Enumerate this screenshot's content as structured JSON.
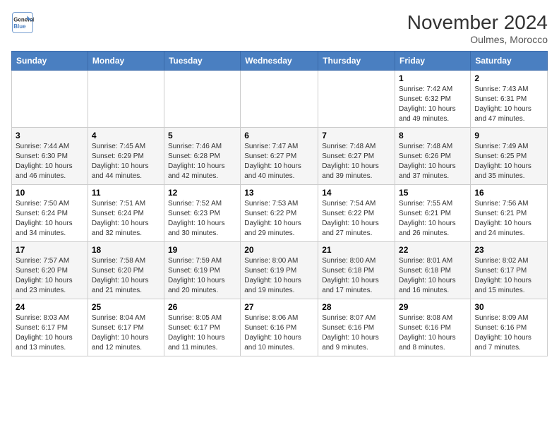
{
  "logo": {
    "line1": "General",
    "line2": "Blue"
  },
  "title": "November 2024",
  "location": "Oulmes, Morocco",
  "headers": [
    "Sunday",
    "Monday",
    "Tuesday",
    "Wednesday",
    "Thursday",
    "Friday",
    "Saturday"
  ],
  "weeks": [
    [
      {
        "day": "",
        "info": ""
      },
      {
        "day": "",
        "info": ""
      },
      {
        "day": "",
        "info": ""
      },
      {
        "day": "",
        "info": ""
      },
      {
        "day": "",
        "info": ""
      },
      {
        "day": "1",
        "info": "Sunrise: 7:42 AM\nSunset: 6:32 PM\nDaylight: 10 hours and 49 minutes."
      },
      {
        "day": "2",
        "info": "Sunrise: 7:43 AM\nSunset: 6:31 PM\nDaylight: 10 hours and 47 minutes."
      }
    ],
    [
      {
        "day": "3",
        "info": "Sunrise: 7:44 AM\nSunset: 6:30 PM\nDaylight: 10 hours and 46 minutes."
      },
      {
        "day": "4",
        "info": "Sunrise: 7:45 AM\nSunset: 6:29 PM\nDaylight: 10 hours and 44 minutes."
      },
      {
        "day": "5",
        "info": "Sunrise: 7:46 AM\nSunset: 6:28 PM\nDaylight: 10 hours and 42 minutes."
      },
      {
        "day": "6",
        "info": "Sunrise: 7:47 AM\nSunset: 6:27 PM\nDaylight: 10 hours and 40 minutes."
      },
      {
        "day": "7",
        "info": "Sunrise: 7:48 AM\nSunset: 6:27 PM\nDaylight: 10 hours and 39 minutes."
      },
      {
        "day": "8",
        "info": "Sunrise: 7:48 AM\nSunset: 6:26 PM\nDaylight: 10 hours and 37 minutes."
      },
      {
        "day": "9",
        "info": "Sunrise: 7:49 AM\nSunset: 6:25 PM\nDaylight: 10 hours and 35 minutes."
      }
    ],
    [
      {
        "day": "10",
        "info": "Sunrise: 7:50 AM\nSunset: 6:24 PM\nDaylight: 10 hours and 34 minutes."
      },
      {
        "day": "11",
        "info": "Sunrise: 7:51 AM\nSunset: 6:24 PM\nDaylight: 10 hours and 32 minutes."
      },
      {
        "day": "12",
        "info": "Sunrise: 7:52 AM\nSunset: 6:23 PM\nDaylight: 10 hours and 30 minutes."
      },
      {
        "day": "13",
        "info": "Sunrise: 7:53 AM\nSunset: 6:22 PM\nDaylight: 10 hours and 29 minutes."
      },
      {
        "day": "14",
        "info": "Sunrise: 7:54 AM\nSunset: 6:22 PM\nDaylight: 10 hours and 27 minutes."
      },
      {
        "day": "15",
        "info": "Sunrise: 7:55 AM\nSunset: 6:21 PM\nDaylight: 10 hours and 26 minutes."
      },
      {
        "day": "16",
        "info": "Sunrise: 7:56 AM\nSunset: 6:21 PM\nDaylight: 10 hours and 24 minutes."
      }
    ],
    [
      {
        "day": "17",
        "info": "Sunrise: 7:57 AM\nSunset: 6:20 PM\nDaylight: 10 hours and 23 minutes."
      },
      {
        "day": "18",
        "info": "Sunrise: 7:58 AM\nSunset: 6:20 PM\nDaylight: 10 hours and 21 minutes."
      },
      {
        "day": "19",
        "info": "Sunrise: 7:59 AM\nSunset: 6:19 PM\nDaylight: 10 hours and 20 minutes."
      },
      {
        "day": "20",
        "info": "Sunrise: 8:00 AM\nSunset: 6:19 PM\nDaylight: 10 hours and 19 minutes."
      },
      {
        "day": "21",
        "info": "Sunrise: 8:00 AM\nSunset: 6:18 PM\nDaylight: 10 hours and 17 minutes."
      },
      {
        "day": "22",
        "info": "Sunrise: 8:01 AM\nSunset: 6:18 PM\nDaylight: 10 hours and 16 minutes."
      },
      {
        "day": "23",
        "info": "Sunrise: 8:02 AM\nSunset: 6:17 PM\nDaylight: 10 hours and 15 minutes."
      }
    ],
    [
      {
        "day": "24",
        "info": "Sunrise: 8:03 AM\nSunset: 6:17 PM\nDaylight: 10 hours and 13 minutes."
      },
      {
        "day": "25",
        "info": "Sunrise: 8:04 AM\nSunset: 6:17 PM\nDaylight: 10 hours and 12 minutes."
      },
      {
        "day": "26",
        "info": "Sunrise: 8:05 AM\nSunset: 6:17 PM\nDaylight: 10 hours and 11 minutes."
      },
      {
        "day": "27",
        "info": "Sunrise: 8:06 AM\nSunset: 6:16 PM\nDaylight: 10 hours and 10 minutes."
      },
      {
        "day": "28",
        "info": "Sunrise: 8:07 AM\nSunset: 6:16 PM\nDaylight: 10 hours and 9 minutes."
      },
      {
        "day": "29",
        "info": "Sunrise: 8:08 AM\nSunset: 6:16 PM\nDaylight: 10 hours and 8 minutes."
      },
      {
        "day": "30",
        "info": "Sunrise: 8:09 AM\nSunset: 6:16 PM\nDaylight: 10 hours and 7 minutes."
      }
    ]
  ]
}
